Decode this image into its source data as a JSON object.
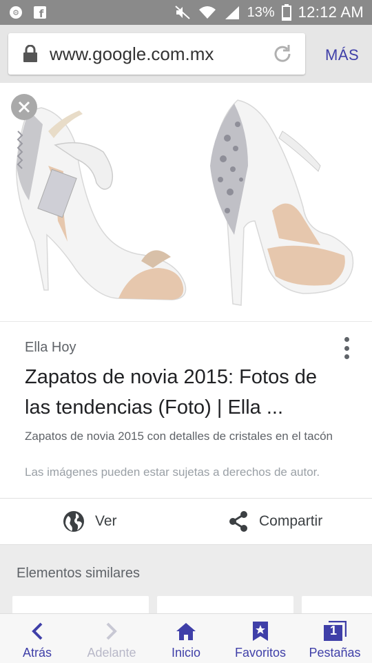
{
  "status_bar": {
    "battery": "13%",
    "time": "12:12 AM"
  },
  "browser": {
    "url": "www.google.com.mx",
    "more_label": "MÁS"
  },
  "result": {
    "source": "Ella Hoy",
    "title": "Zapatos de novia 2015: Fotos de las tendencias (Foto) | Ella ...",
    "description": "Zapatos de novia 2015 con detalles de cristales en el tacón",
    "copyright": "Las imágenes pueden estar sujetas a derechos de autor."
  },
  "actions": {
    "view_label": "Ver",
    "share_label": "Compartir"
  },
  "similar": {
    "label": "Elementos similares"
  },
  "bottom_nav": {
    "back": "Atrás",
    "forward": "Adelante",
    "home": "Inicio",
    "favorites": "Favoritos",
    "tabs": "Pestañas",
    "tab_count": "1"
  },
  "colors": {
    "accent": "#3f3fa8",
    "status_bar": "#8a8a8a",
    "browser_bar": "#e6e6e6"
  }
}
